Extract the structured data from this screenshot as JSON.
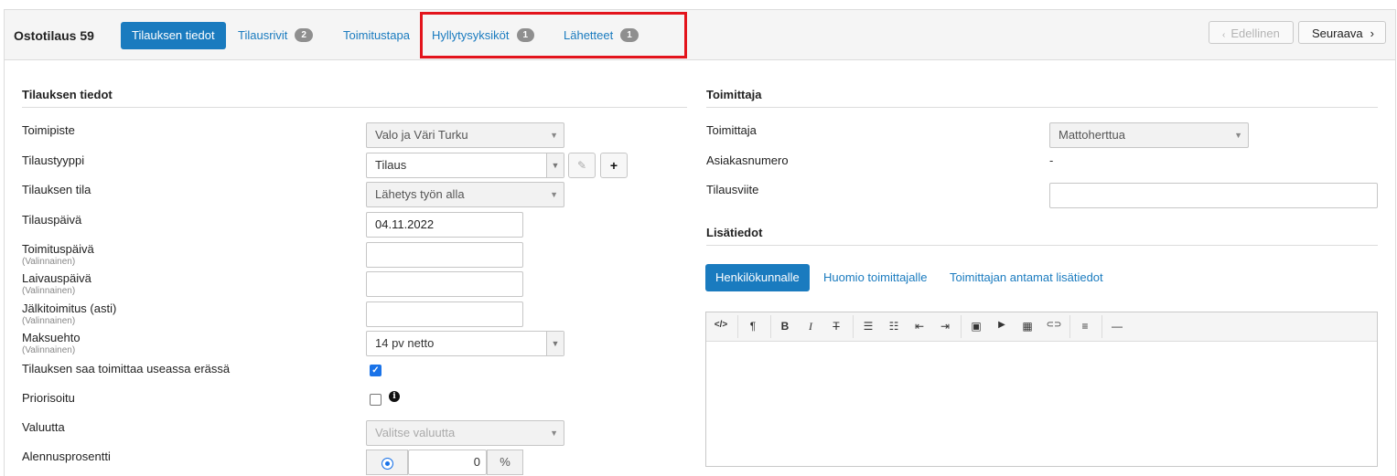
{
  "header": {
    "order_title": "Ostotilaus 59",
    "tabs": [
      {
        "label": "Tilauksen tiedot",
        "active": true
      },
      {
        "label": "Tilausrivit",
        "badge": "2"
      },
      {
        "label": "Toimitustapa"
      },
      {
        "label": "Hyllytysyksiköt",
        "badge": "1"
      },
      {
        "label": "Lähetteet",
        "badge": "1"
      }
    ],
    "prev_label": "Edellinen",
    "next_label": "Seuraava",
    "prev_icon": "chevron-left-icon",
    "next_icon": "chevron-right-icon"
  },
  "order_info": {
    "heading": "Tilauksen tiedot",
    "fields": {
      "toimipiste": {
        "label": "Toimipiste",
        "value": "Valo ja Väri Turku"
      },
      "tilaustyyppi": {
        "label": "Tilaustyyppi",
        "value": "Tilaus",
        "add_label": "+"
      },
      "tila": {
        "label": "Tilauksen tila",
        "value": "Lähetys työn alla"
      },
      "tilauspaiva": {
        "label": "Tilauspäivä",
        "value": "04.11.2022"
      },
      "toimituspaiva": {
        "label": "Toimituspäivä",
        "sub": "(Valinnainen)",
        "value": ""
      },
      "laivauspaiva": {
        "label": "Laivauspäivä",
        "sub": "(Valinnainen)",
        "value": ""
      },
      "jalkitoimitus": {
        "label": "Jälkitoimitus (asti)",
        "sub": "(Valinnainen)",
        "value": ""
      },
      "maksuehto": {
        "label": "Maksuehto",
        "sub": "(Valinnainen)",
        "value": "14 pv netto"
      },
      "useassa_erassa": {
        "label": "Tilauksen saa toimittaa useassa erässä",
        "checked": true
      },
      "priorisoitu": {
        "label": "Priorisoitu",
        "checked": false,
        "info": "i"
      },
      "valuutta": {
        "label": "Valuutta",
        "placeholder": "Valitse valuutta"
      },
      "alennus": {
        "label": "Alennusprosentti",
        "value": "0",
        "unit": "%"
      }
    }
  },
  "supplier": {
    "heading": "Toimittaja",
    "toimittaja_label": "Toimittaja",
    "toimittaja_value": "Mattoherttua",
    "asiakasnumero_label": "Asiakasnumero",
    "asiakasnumero_value": "-",
    "tilausviite_label": "Tilausviite",
    "tilausviite_value": ""
  },
  "extra": {
    "heading": "Lisätiedot",
    "tabs": [
      {
        "label": "Henkilökunnalle",
        "active": true
      },
      {
        "label": "Huomio toimittajalle"
      },
      {
        "label": "Toimittajan antamat lisätiedot"
      }
    ],
    "toolbar": [
      {
        "icon": "code-view-icon",
        "glyph": "</>"
      },
      {
        "icon": "paragraph-style-icon",
        "glyph": "¶"
      },
      {
        "icon": "bold-icon",
        "glyph": "B"
      },
      {
        "icon": "italic-icon",
        "glyph": "I"
      },
      {
        "icon": "strikethrough-icon",
        "glyph": "T"
      },
      {
        "icon": "unordered-list-icon",
        "glyph": "☰"
      },
      {
        "icon": "ordered-list-icon",
        "glyph": "☷"
      },
      {
        "icon": "outdent-icon",
        "glyph": "⇤"
      },
      {
        "icon": "indent-icon",
        "glyph": "⇥"
      },
      {
        "icon": "image-icon",
        "glyph": "▣"
      },
      {
        "icon": "video-icon",
        "glyph": "▶"
      },
      {
        "icon": "table-icon",
        "glyph": "▦"
      },
      {
        "icon": "link-icon",
        "glyph": "⊂⊃"
      },
      {
        "icon": "align-icon",
        "glyph": "≡"
      },
      {
        "icon": "horizontal-rule-icon",
        "glyph": "—"
      }
    ],
    "content": ""
  },
  "colors": {
    "accent": "#1a7bbf",
    "highlight": "#e3141c",
    "checkbox": "#1a73e8"
  }
}
